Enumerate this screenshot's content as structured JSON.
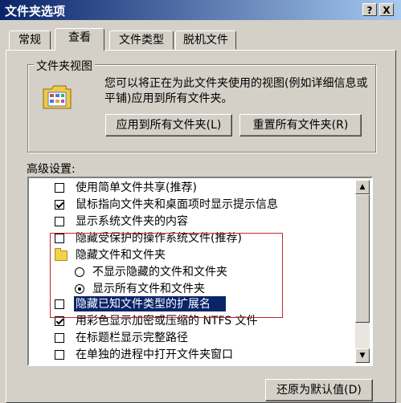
{
  "window": {
    "title": "文件夹选项",
    "help_button": "?",
    "close_button": "X"
  },
  "tabs": [
    {
      "label": "常规"
    },
    {
      "label": "查看"
    },
    {
      "label": "文件类型"
    },
    {
      "label": "脱机文件"
    }
  ],
  "folder_views": {
    "group_label": "文件夹视图",
    "description": "您可以将正在为此文件夹使用的视图(例如详细信息或平铺)应用到所有文件夹。",
    "apply_button": "应用到所有文件夹(L)",
    "reset_button": "重置所有文件夹(R)"
  },
  "advanced": {
    "label": "高级设置:",
    "items": [
      {
        "type": "checkbox",
        "checked": false,
        "label": "使用简单文件共享(推荐)"
      },
      {
        "type": "checkbox",
        "checked": true,
        "label": "鼠标指向文件夹和桌面项时显示提示信息"
      },
      {
        "type": "checkbox",
        "checked": false,
        "label": "显示系统文件夹的内容"
      },
      {
        "type": "checkbox",
        "checked": false,
        "label": "隐藏受保护的操作系统文件(推荐)"
      },
      {
        "type": "folder",
        "label": "隐藏文件和文件夹"
      },
      {
        "type": "radio",
        "selected": false,
        "label": "不显示隐藏的文件和文件夹"
      },
      {
        "type": "radio",
        "selected": true,
        "label": "显示所有文件和文件夹"
      },
      {
        "type": "checkbox",
        "checked": false,
        "label": "隐藏已知文件类型的扩展名"
      },
      {
        "type": "checkbox",
        "checked": true,
        "label": "用彩色显示加密或压缩的 NTFS 文件"
      },
      {
        "type": "checkbox",
        "checked": false,
        "label": "在标题栏显示完整路径"
      },
      {
        "type": "checkbox",
        "checked": false,
        "label": "在单独的进程中打开文件夹窗口"
      }
    ]
  },
  "restore_button": "还原为默认值(D)",
  "icons": {
    "scroll_up": "▲",
    "scroll_down": "▼",
    "folder_view_icon": "folder-view-icon"
  }
}
